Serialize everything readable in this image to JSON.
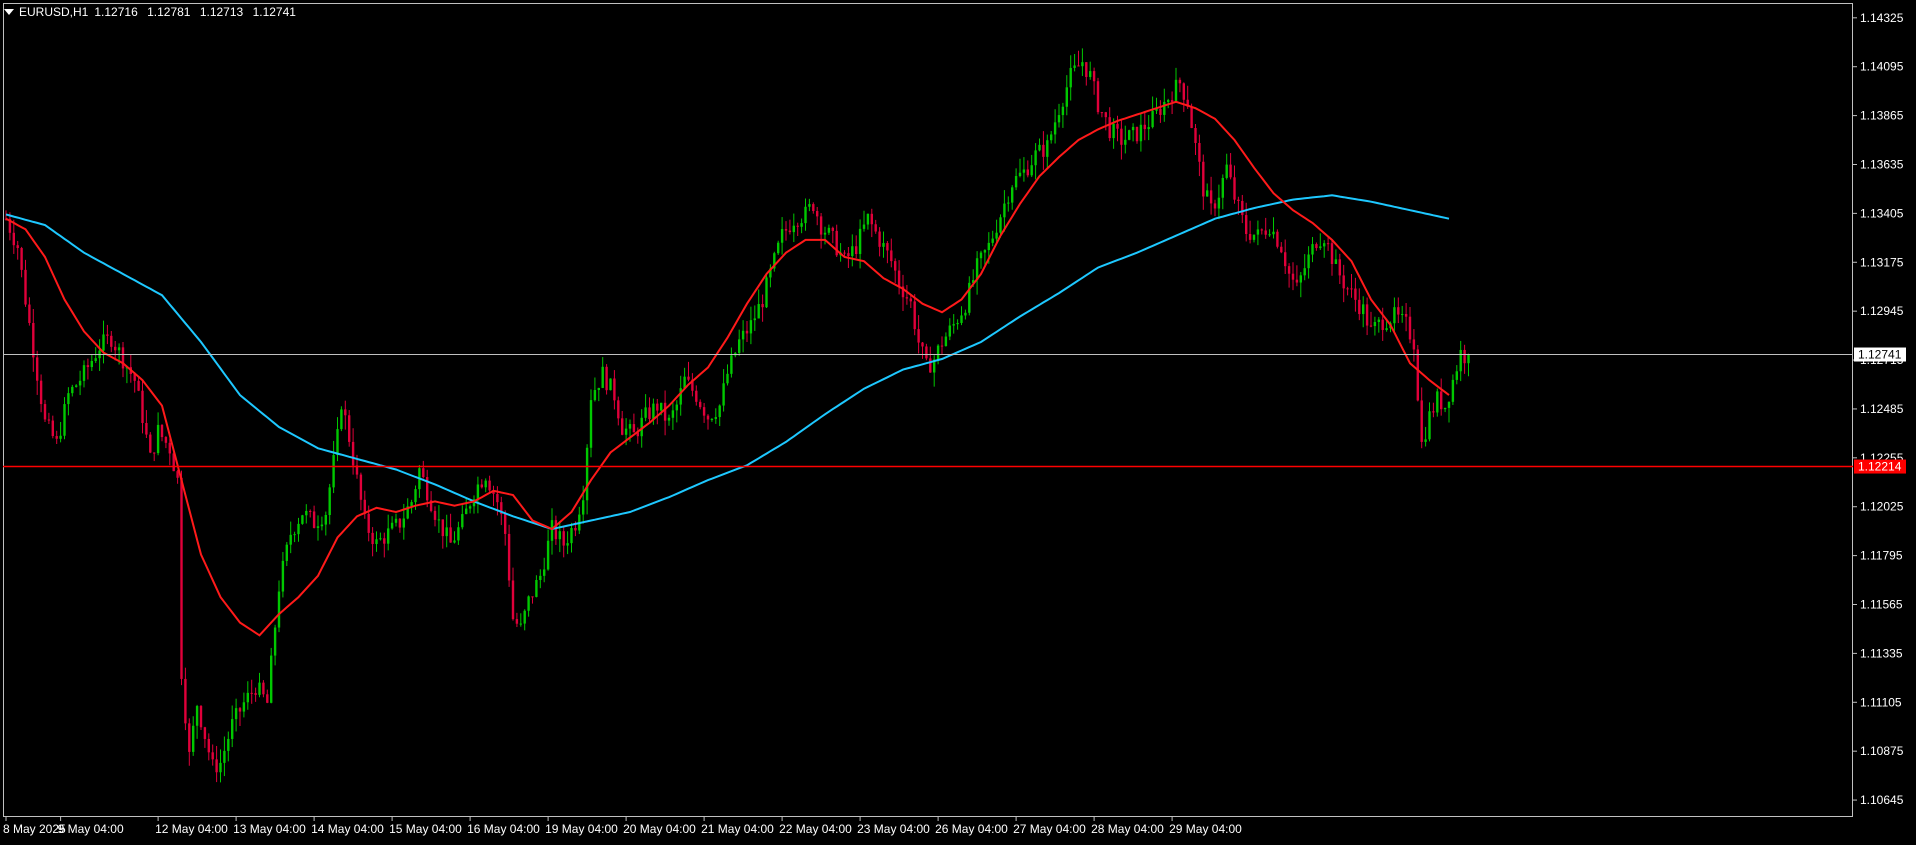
{
  "header": {
    "symbol_label": "EURUSD,H1",
    "open": "1.12716",
    "high": "1.12781",
    "low": "1.12713",
    "close": "1.12741"
  },
  "colors": {
    "background": "#000000",
    "grid_frame": "#c0c0c0",
    "bull_candle": "#00c800",
    "bear_candle": "#e0003a",
    "ma_fast": "#ff1a1a",
    "ma_slow": "#1ec8ff",
    "current_price_line": "#c0c0c0",
    "level_line": "#ff0000"
  },
  "price_axis": {
    "labels": [
      "1.14325",
      "1.14095",
      "1.13865",
      "1.13635",
      "1.13405",
      "1.13175",
      "1.12945",
      "1.12715",
      "1.12485",
      "1.12255",
      "1.12025",
      "1.11795",
      "1.11565",
      "1.11335",
      "1.11105",
      "1.10875",
      "1.10645"
    ],
    "current_price_tag": "1.12741",
    "level_tag": "1.12214"
  },
  "time_axis": {
    "labels": [
      "8 May 2025",
      "9 May 04:00",
      "12 May 04:00",
      "13 May 04:00",
      "14 May 04:00",
      "15 May 04:00",
      "16 May 04:00",
      "19 May 04:00",
      "20 May 04:00",
      "21 May 04:00",
      "22 May 04:00",
      "23 May 04:00",
      "26 May 04:00",
      "27 May 04:00",
      "28 May 04:00",
      "29 May 04:00"
    ]
  },
  "chart_data": {
    "type": "candlestick",
    "symbol": "EURUSD",
    "timeframe": "H1",
    "ylim": [
      1.1057,
      1.1439
    ],
    "current_price": 1.12741,
    "horizontal_level": 1.12214,
    "day_anchors": [
      {
        "label": "8 May 2025",
        "bar": 0
      },
      {
        "label": "9 May 04:00",
        "bar": 14
      },
      {
        "label": "12 May 04:00",
        "bar": 39
      },
      {
        "label": "13 May 04:00",
        "bar": 59
      },
      {
        "label": "14 May 04:00",
        "bar": 79
      },
      {
        "label": "15 May 04:00",
        "bar": 99
      },
      {
        "label": "16 May 04:00",
        "bar": 119
      },
      {
        "label": "19 May 04:00",
        "bar": 139
      },
      {
        "label": "20 May 04:00",
        "bar": 159
      },
      {
        "label": "21 May 04:00",
        "bar": 179
      },
      {
        "label": "22 May 04:00",
        "bar": 199
      },
      {
        "label": "23 May 04:00",
        "bar": 219
      },
      {
        "label": "26 May 04:00",
        "bar": 239
      },
      {
        "label": "27 May 04:00",
        "bar": 259
      },
      {
        "label": "28 May 04:00",
        "bar": 279
      },
      {
        "label": "29 May 04:00",
        "bar": 299
      }
    ],
    "close_path": [
      [
        0,
        1.1338
      ],
      [
        3,
        1.1325
      ],
      [
        5,
        1.13
      ],
      [
        10,
        1.1242
      ],
      [
        13,
        1.1232
      ],
      [
        16,
        1.1255
      ],
      [
        20,
        1.1265
      ],
      [
        24,
        1.1278
      ],
      [
        27,
        1.1282
      ],
      [
        30,
        1.1272
      ],
      [
        33,
        1.1262
      ],
      [
        35,
        1.1245
      ],
      [
        37,
        1.1225
      ],
      [
        39,
        1.1238
      ],
      [
        42,
        1.123
      ],
      [
        44,
        1.1215
      ],
      [
        45,
        1.1125
      ],
      [
        47,
        1.1085
      ],
      [
        49,
        1.111
      ],
      [
        51,
        1.1095
      ],
      [
        53,
        1.108
      ],
      [
        55,
        1.1082
      ],
      [
        58,
        1.11
      ],
      [
        61,
        1.111
      ],
      [
        64,
        1.1118
      ],
      [
        67,
        1.111
      ],
      [
        70,
        1.1165
      ],
      [
        73,
        1.119
      ],
      [
        76,
        1.12
      ],
      [
        79,
        1.1195
      ],
      [
        82,
        1.12
      ],
      [
        85,
        1.1235
      ],
      [
        86,
        1.1252
      ],
      [
        88,
        1.1235
      ],
      [
        90,
        1.1215
      ],
      [
        92,
        1.1195
      ],
      [
        95,
        1.1185
      ],
      [
        98,
        1.119
      ],
      [
        101,
        1.1195
      ],
      [
        104,
        1.1205
      ],
      [
        106,
        1.122
      ],
      [
        108,
        1.121
      ],
      [
        111,
        1.1195
      ],
      [
        114,
        1.1185
      ],
      [
        117,
        1.1195
      ],
      [
        120,
        1.121
      ],
      [
        123,
        1.1218
      ],
      [
        126,
        1.1205
      ],
      [
        128,
        1.119
      ],
      [
        130,
        1.115
      ],
      [
        132,
        1.1145
      ],
      [
        134,
        1.1158
      ],
      [
        137,
        1.117
      ],
      [
        140,
        1.1192
      ],
      [
        143,
        1.1185
      ],
      [
        146,
        1.1195
      ],
      [
        148,
        1.121
      ],
      [
        150,
        1.1255
      ],
      [
        153,
        1.1265
      ],
      [
        156,
        1.1255
      ],
      [
        158,
        1.124
      ],
      [
        161,
        1.1236
      ],
      [
        164,
        1.1245
      ],
      [
        167,
        1.125
      ],
      [
        170,
        1.1242
      ],
      [
        172,
        1.125
      ],
      [
        174,
        1.1262
      ],
      [
        177,
        1.1255
      ],
      [
        180,
        1.1245
      ],
      [
        183,
        1.125
      ],
      [
        185,
        1.1265
      ],
      [
        188,
        1.128
      ],
      [
        191,
        1.1288
      ],
      [
        194,
        1.13
      ],
      [
        197,
        1.1318
      ],
      [
        199,
        1.133
      ],
      [
        202,
        1.1338
      ],
      [
        205,
        1.134
      ],
      [
        207,
        1.1345
      ],
      [
        209,
        1.1335
      ],
      [
        212,
        1.1328
      ],
      [
        215,
        1.1318
      ],
      [
        218,
        1.1325
      ],
      [
        221,
        1.1338
      ],
      [
        224,
        1.1328
      ],
      [
        227,
        1.1318
      ],
      [
        229,
        1.1308
      ],
      [
        232,
        1.1298
      ],
      [
        234,
        1.128
      ],
      [
        236,
        1.1268
      ],
      [
        238,
        1.1272
      ],
      [
        240,
        1.128
      ],
      [
        243,
        1.1288
      ],
      [
        246,
        1.1298
      ],
      [
        249,
        1.1315
      ],
      [
        252,
        1.1325
      ],
      [
        255,
        1.134
      ],
      [
        258,
        1.1355
      ],
      [
        261,
        1.136
      ],
      [
        264,
        1.1368
      ],
      [
        267,
        1.1372
      ],
      [
        270,
        1.139
      ],
      [
        273,
        1.1405
      ],
      [
        276,
        1.1412
      ],
      [
        278,
        1.1405
      ],
      [
        280,
        1.1392
      ],
      [
        283,
        1.138
      ],
      [
        286,
        1.1375
      ],
      [
        290,
        1.1378
      ],
      [
        294,
        1.1385
      ],
      [
        298,
        1.1395
      ],
      [
        301,
        1.1402
      ],
      [
        303,
        1.1393
      ],
      [
        305,
        1.1372
      ],
      [
        307,
        1.1352
      ],
      [
        309,
        1.1342
      ],
      [
        311,
        1.135
      ],
      [
        313,
        1.1362
      ],
      [
        315,
        1.1348
      ],
      [
        318,
        1.1332
      ],
      [
        321,
        1.133
      ],
      [
        324,
        1.1335
      ],
      [
        327,
        1.1325
      ],
      [
        329,
        1.1312
      ],
      [
        331,
        1.1305
      ],
      [
        333,
        1.1315
      ],
      [
        336,
        1.1328
      ],
      [
        338,
        1.133
      ],
      [
        341,
        1.1315
      ],
      [
        343,
        1.1308
      ],
      [
        346,
        1.13
      ],
      [
        348,
        1.1295
      ],
      [
        350,
        1.1285
      ],
      [
        353,
        1.129
      ],
      [
        356,
        1.1292
      ],
      [
        359,
        1.1288
      ],
      [
        361,
        1.128
      ],
      [
        363,
        1.1232
      ],
      [
        365,
        1.1245
      ],
      [
        367,
        1.1253
      ],
      [
        369,
        1.125
      ],
      [
        371,
        1.1262
      ],
      [
        373,
        1.1275
      ],
      [
        375,
        1.1272
      ]
    ],
    "ma_fast_path": [
      [
        0,
        1.1338
      ],
      [
        5,
        1.1333
      ],
      [
        10,
        1.132
      ],
      [
        15,
        1.13
      ],
      [
        20,
        1.1285
      ],
      [
        25,
        1.1275
      ],
      [
        30,
        1.127
      ],
      [
        35,
        1.1262
      ],
      [
        40,
        1.125
      ],
      [
        45,
        1.1215
      ],
      [
        50,
        1.118
      ],
      [
        55,
        1.116
      ],
      [
        60,
        1.1148
      ],
      [
        65,
        1.1142
      ],
      [
        70,
        1.1152
      ],
      [
        75,
        1.116
      ],
      [
        80,
        1.117
      ],
      [
        85,
        1.1188
      ],
      [
        90,
        1.1198
      ],
      [
        95,
        1.1202
      ],
      [
        100,
        1.12
      ],
      [
        105,
        1.1203
      ],
      [
        110,
        1.1205
      ],
      [
        115,
        1.1203
      ],
      [
        120,
        1.1205
      ],
      [
        125,
        1.121
      ],
      [
        130,
        1.1208
      ],
      [
        135,
        1.1196
      ],
      [
        140,
        1.1192
      ],
      [
        145,
        1.12
      ],
      [
        150,
        1.1215
      ],
      [
        155,
        1.1228
      ],
      [
        160,
        1.1235
      ],
      [
        165,
        1.1242
      ],
      [
        170,
        1.125
      ],
      [
        175,
        1.126
      ],
      [
        180,
        1.1268
      ],
      [
        185,
        1.1282
      ],
      [
        190,
        1.1298
      ],
      [
        195,
        1.1312
      ],
      [
        200,
        1.1322
      ],
      [
        205,
        1.1328
      ],
      [
        210,
        1.1328
      ],
      [
        215,
        1.132
      ],
      [
        220,
        1.1318
      ],
      [
        225,
        1.131
      ],
      [
        230,
        1.1305
      ],
      [
        235,
        1.1298
      ],
      [
        240,
        1.1294
      ],
      [
        245,
        1.13
      ],
      [
        250,
        1.1312
      ],
      [
        255,
        1.133
      ],
      [
        260,
        1.1345
      ],
      [
        265,
        1.1358
      ],
      [
        270,
        1.1367
      ],
      [
        275,
        1.1375
      ],
      [
        280,
        1.138
      ],
      [
        285,
        1.1384
      ],
      [
        290,
        1.1387
      ],
      [
        295,
        1.139
      ],
      [
        300,
        1.1393
      ],
      [
        305,
        1.139
      ],
      [
        310,
        1.1385
      ],
      [
        315,
        1.1375
      ],
      [
        320,
        1.1362
      ],
      [
        325,
        1.135
      ],
      [
        330,
        1.1342
      ],
      [
        335,
        1.1336
      ],
      [
        340,
        1.1328
      ],
      [
        345,
        1.1318
      ],
      [
        350,
        1.13
      ],
      [
        355,
        1.1288
      ],
      [
        360,
        1.127
      ],
      [
        365,
        1.1262
      ],
      [
        370,
        1.1255
      ]
    ],
    "ma_slow_path": [
      [
        0,
        1.134
      ],
      [
        10,
        1.1335
      ],
      [
        20,
        1.1322
      ],
      [
        30,
        1.1312
      ],
      [
        40,
        1.1302
      ],
      [
        50,
        1.128
      ],
      [
        60,
        1.1255
      ],
      [
        70,
        1.124
      ],
      [
        80,
        1.123
      ],
      [
        90,
        1.1225
      ],
      [
        100,
        1.122
      ],
      [
        110,
        1.1213
      ],
      [
        120,
        1.1205
      ],
      [
        130,
        1.1198
      ],
      [
        140,
        1.1192
      ],
      [
        150,
        1.1196
      ],
      [
        160,
        1.12
      ],
      [
        170,
        1.1207
      ],
      [
        180,
        1.1215
      ],
      [
        190,
        1.1222
      ],
      [
        200,
        1.1233
      ],
      [
        210,
        1.1246
      ],
      [
        220,
        1.1258
      ],
      [
        230,
        1.1267
      ],
      [
        240,
        1.1272
      ],
      [
        250,
        1.128
      ],
      [
        260,
        1.1292
      ],
      [
        270,
        1.1303
      ],
      [
        280,
        1.1315
      ],
      [
        290,
        1.1322
      ],
      [
        300,
        1.133
      ],
      [
        310,
        1.1338
      ],
      [
        320,
        1.1343
      ],
      [
        330,
        1.1347
      ],
      [
        340,
        1.1349
      ],
      [
        350,
        1.1346
      ],
      [
        360,
        1.1342
      ],
      [
        370,
        1.1338
      ]
    ],
    "notes_excluded": false
  }
}
